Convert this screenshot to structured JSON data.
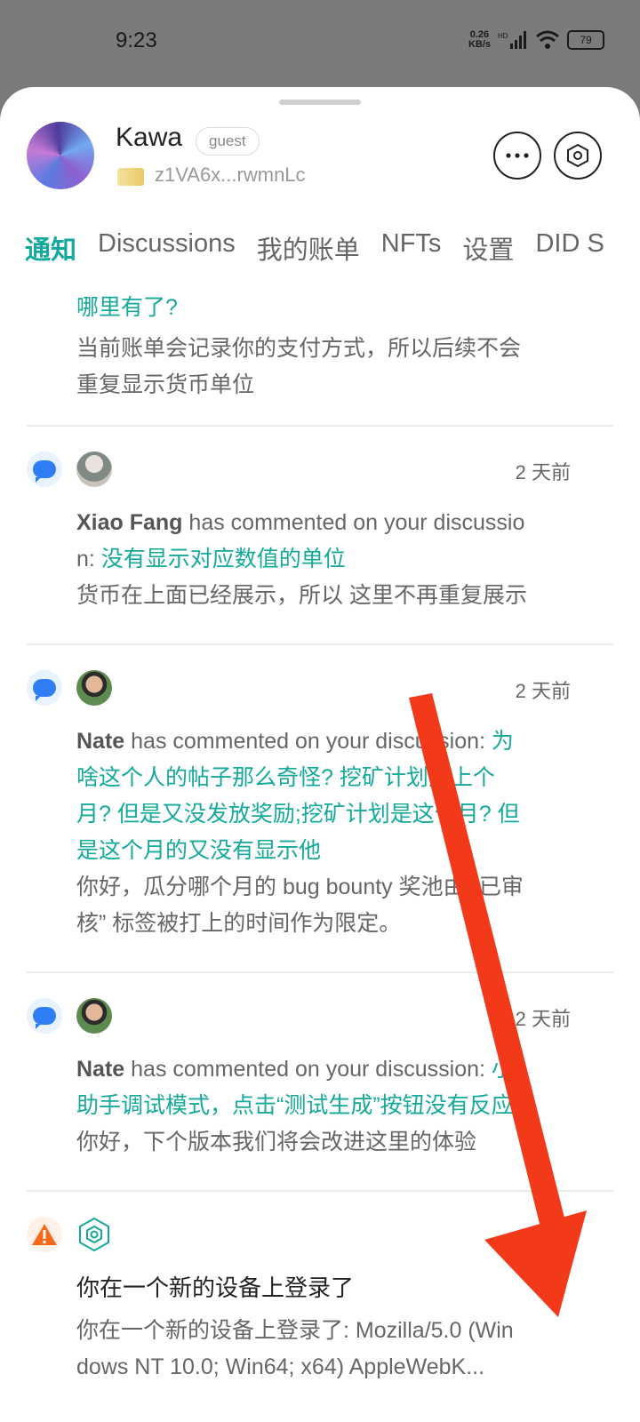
{
  "status_bar": {
    "time": "9:23",
    "net_speed": "0.26",
    "net_unit": "KB/s",
    "battery": "79"
  },
  "profile": {
    "name": "Kawa",
    "role": "guest",
    "wallet": "z1VA6x...rwmnLc"
  },
  "tabs": [
    "通知",
    "Discussions",
    "我的账单",
    "NFTs",
    "设置",
    "DID S"
  ],
  "notifications": [
    {
      "title_tail": "哪里有了?",
      "body": [
        "当前账单会记录你的支付方式，所以后续不会",
        "重复显示货币单位"
      ]
    },
    {
      "time": "2 天前",
      "author": "Xiao Fang",
      "action": " has commented on your discussio",
      "action2": "n: ",
      "link": "没有显示对应数值的单位",
      "body": "货币在上面已经展示，所以 这里不再重复展示"
    },
    {
      "time": "2 天前",
      "author": "Nate",
      "action": " has commented on your discussion: ",
      "link1": "为",
      "link2": "啥这个人的帖子那么奇怪? 挖矿计划是上个",
      "link3": "月? 但是又没发放奖励;挖矿计划是这个月? 但",
      "link4": "是这个月的又没有显示他",
      "body1": "你好，瓜分哪个月的 bug bounty 奖池由 “已审",
      "body2": "核” 标签被打上的时间作为限定。"
    },
    {
      "time": "2 天前",
      "author": "Nate",
      "action": " has commented on your discussion: ",
      "link1": "小",
      "link2": "助手调试模式，点击“测试生成”按钮没有反应",
      "body": "你好，下个版本我们将会改进这里的体验"
    },
    {
      "title": "你在一个新的设备上登录了",
      "body1": "你在一个新的设备上登录了: Mozilla/5.0 (Win",
      "body2": "dows NT 10.0; Win64; x64) AppleWebK..."
    }
  ],
  "colors": {
    "accent": "#14a99a",
    "link_blue": "#2f7ef5",
    "warning": "#f56a1a",
    "annotation_arrow": "#f23a1b"
  }
}
